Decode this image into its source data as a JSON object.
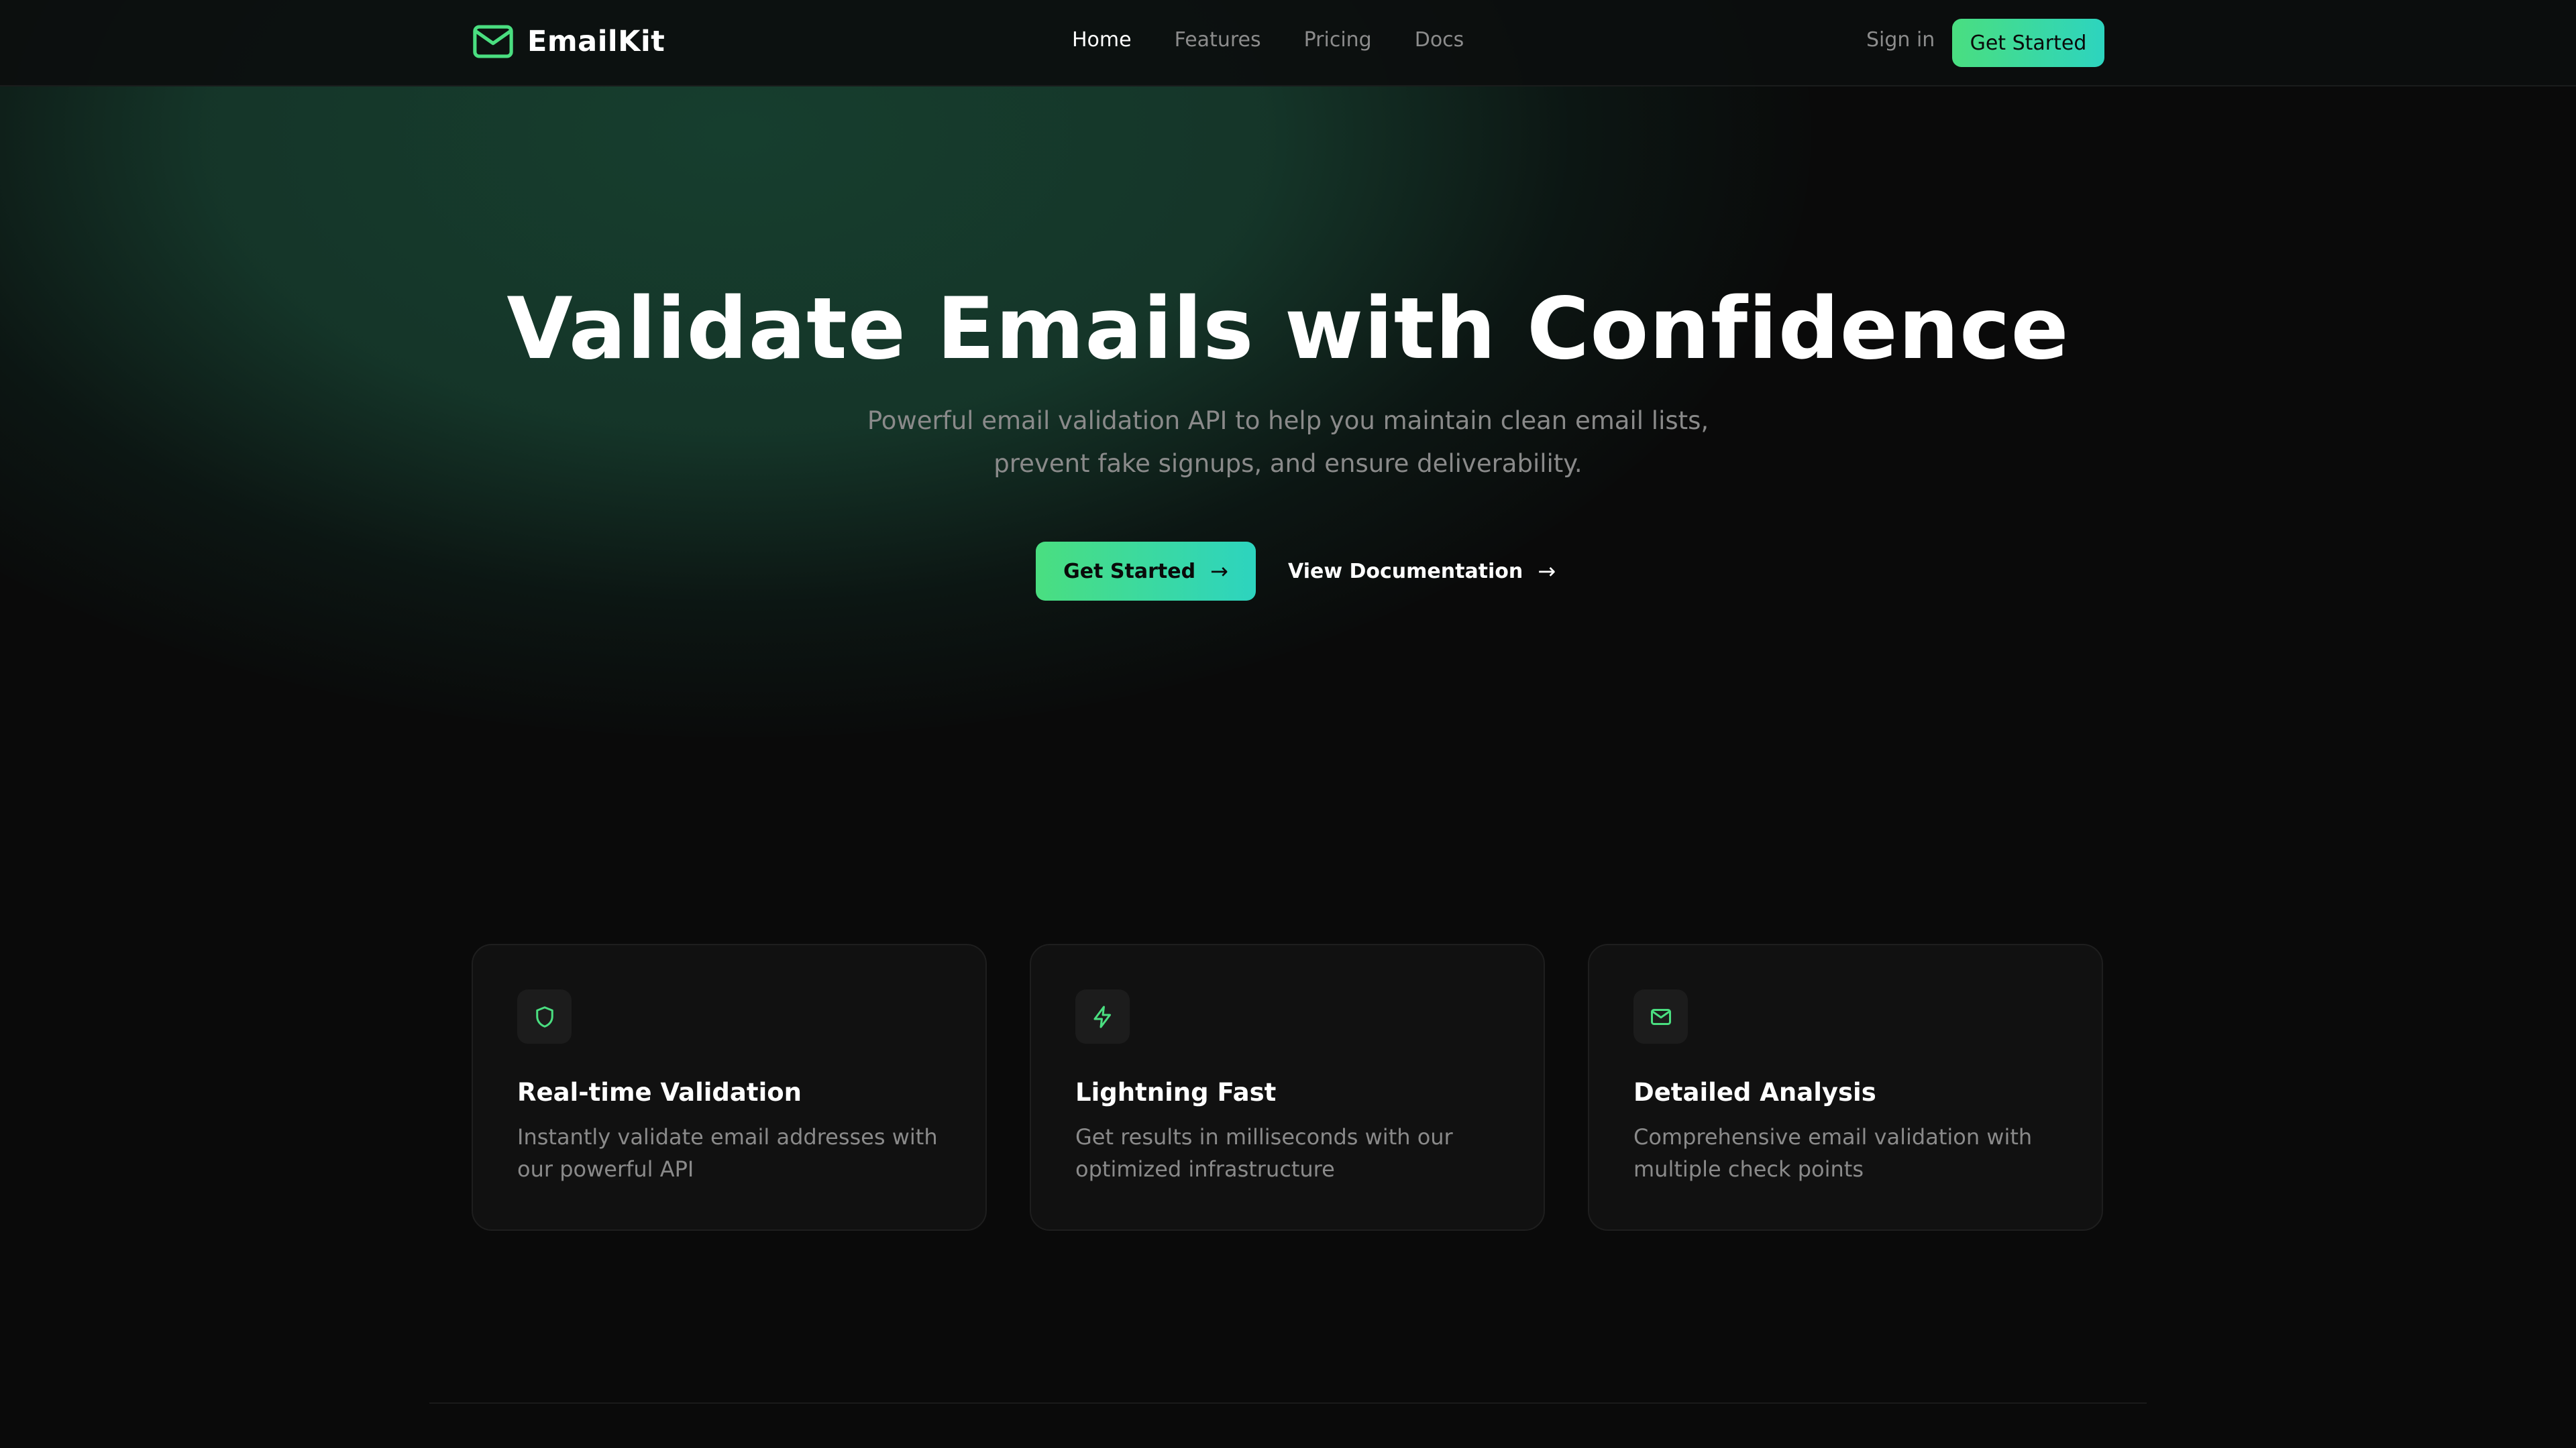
{
  "brand": {
    "name": "EmailKit",
    "icon": "mail-icon",
    "accent_start": "#4ade80",
    "accent_end": "#2dd4bf"
  },
  "nav": {
    "items": [
      {
        "label": "Home",
        "active": true
      },
      {
        "label": "Features",
        "active": false
      },
      {
        "label": "Pricing",
        "active": false
      },
      {
        "label": "Docs",
        "active": false
      }
    ],
    "sign_in": "Sign in",
    "cta": "Get Started"
  },
  "hero": {
    "title": "Validate Emails with Confidence",
    "subtitle_line1": "Powerful email validation API to help you maintain clean email lists,",
    "subtitle_line2": "prevent fake signups, and ensure deliverability.",
    "primary_cta": "Get Started",
    "primary_cta_icon": "arrow-right-icon",
    "secondary_cta": "View Documentation",
    "secondary_cta_icon": "arrow-right-icon"
  },
  "features": [
    {
      "icon": "shield-icon",
      "title": "Real-time Validation",
      "description": "Instantly validate email addresses with our powerful API"
    },
    {
      "icon": "lightning-icon",
      "title": "Lightning Fast",
      "description": "Get results in milliseconds with our optimized infrastructure"
    },
    {
      "icon": "mail-icon",
      "title": "Detailed Analysis",
      "description": "Comprehensive email validation with multiple check points"
    }
  ]
}
